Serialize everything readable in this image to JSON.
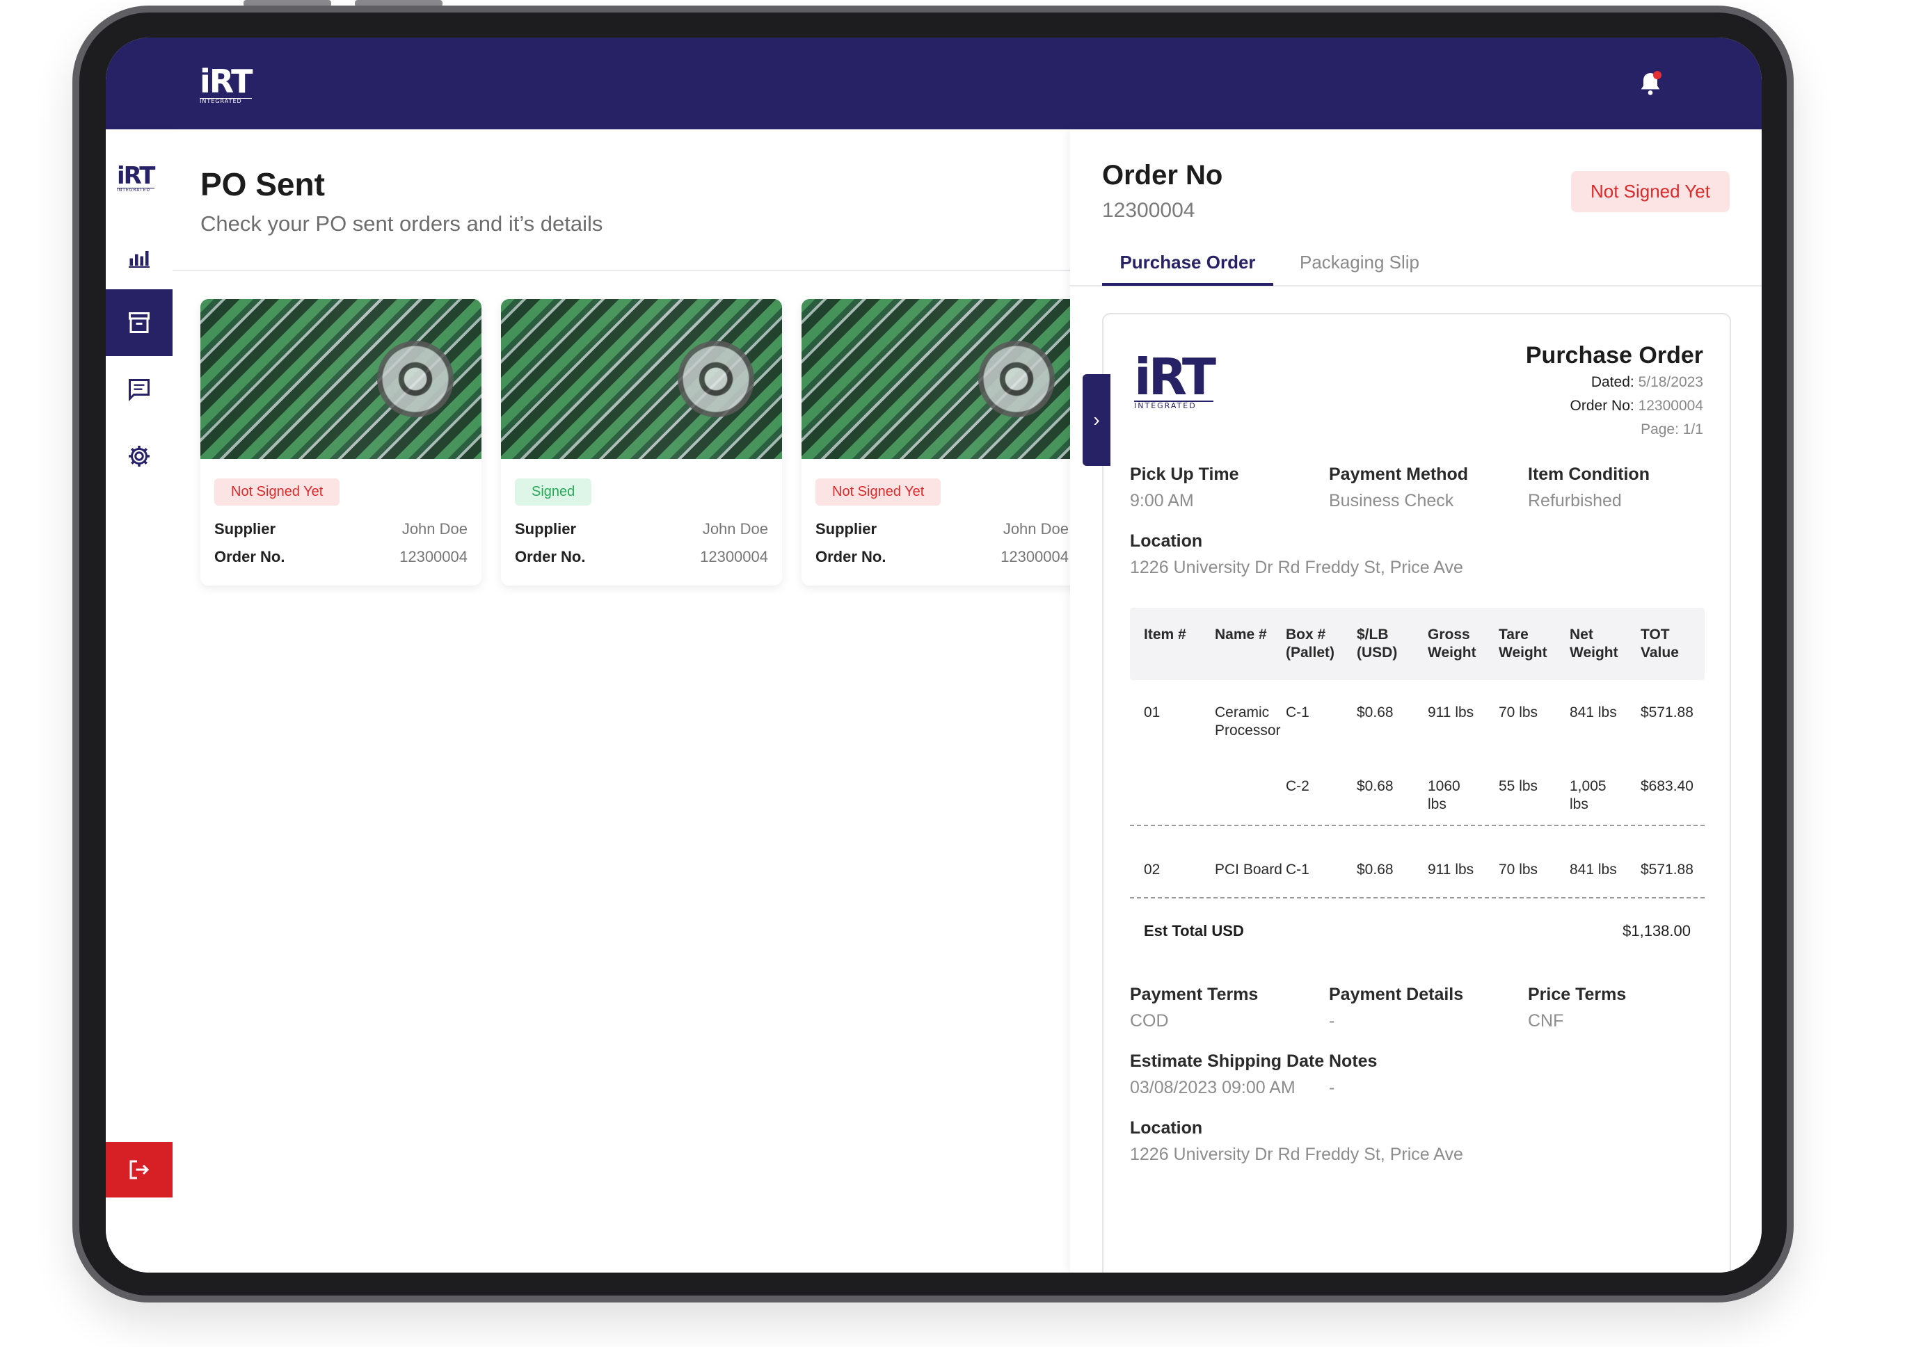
{
  "topbar": {
    "brand": "iRT",
    "brand_sub": "INTEGRATED",
    "notification_icon": "bell-icon"
  },
  "sidebar": {
    "logo": "iRT",
    "logo_sub": "INTEGRATED",
    "items": [
      {
        "name": "dashboard",
        "icon": "bar-chart-icon",
        "active": false
      },
      {
        "name": "orders",
        "icon": "archive-icon",
        "active": true
      },
      {
        "name": "messages",
        "icon": "message-icon",
        "active": false
      },
      {
        "name": "settings",
        "icon": "gear-icon",
        "active": false
      }
    ],
    "logout_icon": "logout-icon"
  },
  "main": {
    "title": "PO Sent",
    "subtitle": "Check your PO sent orders and it’s details",
    "cards": [
      {
        "status": "Not Signed Yet",
        "status_type": "red",
        "supplier_label": "Supplier",
        "supplier": "John Doe",
        "order_label": "Order No.",
        "order_no": "12300004"
      },
      {
        "status": "Signed",
        "status_type": "green",
        "supplier_label": "Supplier",
        "supplier": "John Doe",
        "order_label": "Order No.",
        "order_no": "12300004"
      },
      {
        "status": "Not Signed Yet",
        "status_type": "red",
        "supplier_label": "Supplier",
        "supplier": "John Doe",
        "order_label": "Order No.",
        "order_no": "12300004"
      }
    ]
  },
  "panel": {
    "order_label": "Order No",
    "order_no": "12300004",
    "status": "Not Signed Yet",
    "tabs": [
      "Purchase Order",
      "Packaging Slip"
    ],
    "doc": {
      "logo": "iRT",
      "logo_sub": "INTEGRATED",
      "title": "Purchase Order",
      "dated_label": "Dated:",
      "dated": "5/18/2023",
      "order_label": "Order No:",
      "order_no": "12300004",
      "page_label": "Page:",
      "page": "1/1",
      "pickup_label": "Pick Up Time",
      "pickup": "9:00 AM",
      "payment_method_label": "Payment Method",
      "payment_method": "Business Check",
      "condition_label": "Item Condition",
      "condition": "Refurbished",
      "location_label": "Location",
      "location": "1226 University Dr Rd Freddy St, Price Ave",
      "table": {
        "headers": [
          "Item #",
          "Name #",
          "Box #\n(Pallet)",
          "$/LB\n(USD)",
          "Gross\nWeight",
          "Tare\nWeight",
          "Net\nWeight",
          "TOT\nValue"
        ],
        "rows": [
          [
            "01",
            "Ceramic\nProcessor",
            "C-1",
            "$0.68",
            "911 lbs",
            "70 lbs",
            "841 lbs",
            "$571.88"
          ],
          [
            "",
            "",
            "C-2",
            "$0.68",
            "1060\nlbs",
            "55 lbs",
            "1,005\nlbs",
            "$683.40"
          ],
          [
            "02",
            "PCI Board",
            "C-1",
            "$0.68",
            "911 lbs",
            "70 lbs",
            "841 lbs",
            "$571.88"
          ]
        ],
        "total_label": "Est Total USD",
        "total": "$1,138.00"
      },
      "payment_terms_label": "Payment Terms",
      "payment_terms": "COD",
      "payment_details_label": "Payment Details",
      "payment_details": "-",
      "price_terms_label": "Price Terms",
      "price_terms": "CNF",
      "shipping_label": "Estimate Shipping Date",
      "shipping": "03/08/2023 09:00 AM",
      "notes_label": "Notes",
      "notes": "-",
      "location2_label": "Location",
      "location2": "1226 University Dr Rd Freddy St, Price Ave"
    }
  },
  "colors": {
    "brand": "#272166",
    "danger": "#d71f26",
    "success": "#27a857"
  }
}
